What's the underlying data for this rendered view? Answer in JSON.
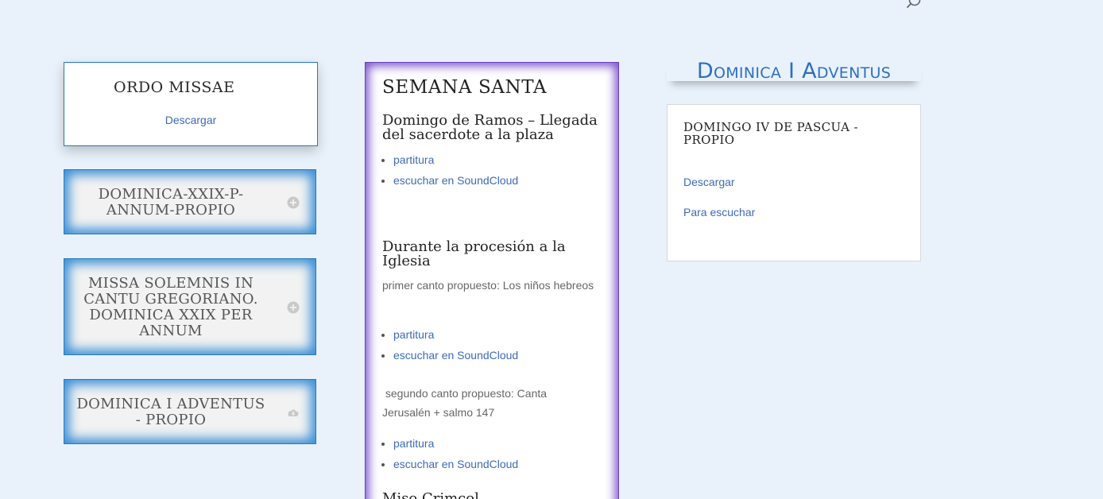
{
  "header": {
    "search_icon": "search-icon"
  },
  "ordo": {
    "title": "ORDO MISSAE",
    "link": "Descargar"
  },
  "toggles": [
    {
      "title": "DOMINICA-XXIX-P-ANNUM-PROPIO",
      "icon": "plus-circle-icon"
    },
    {
      "title": "MISSA SOLEMNIS IN CANTU GREGORIANO. DOMINICA XXIX PER ANNUM",
      "icon": "plus-circle-icon"
    },
    {
      "title": "DOMINICA I ADVENTUS - PROPIO",
      "icon": "cloud-download-icon"
    }
  ],
  "semana": {
    "heading": "SEMANA SANTA",
    "section1": {
      "title": "Domingo de Ramos – Llegada del sacerdote a la plaza",
      "links": [
        "partitura",
        "escuchar en SoundCloud"
      ]
    },
    "section2": {
      "title": "Durante la procesión a la Iglesia",
      "text1": "primer canto propuesto: Los niños hebreos",
      "links1": [
        "partitura",
        "escuchar en SoundCloud"
      ],
      "text2": " segundo canto propuesto: Canta Jerusalén + salmo 147",
      "links2": [
        "partitura",
        "escuchar en SoundCloud"
      ]
    },
    "section3": {
      "title": "Miso Crimcol"
    }
  },
  "dominica": {
    "title": "Dominica I Adventus"
  },
  "domingo": {
    "title": "DOMINGO IV DE PASCUA - PROPIO",
    "link1": "Descargar",
    "link2": "Para escuchar"
  },
  "colors": {
    "background": "#e9f2fb",
    "accent_blue": "#2f6fc2",
    "link_blue": "#3d6ab8",
    "purple_border": "#6a3fc0"
  }
}
